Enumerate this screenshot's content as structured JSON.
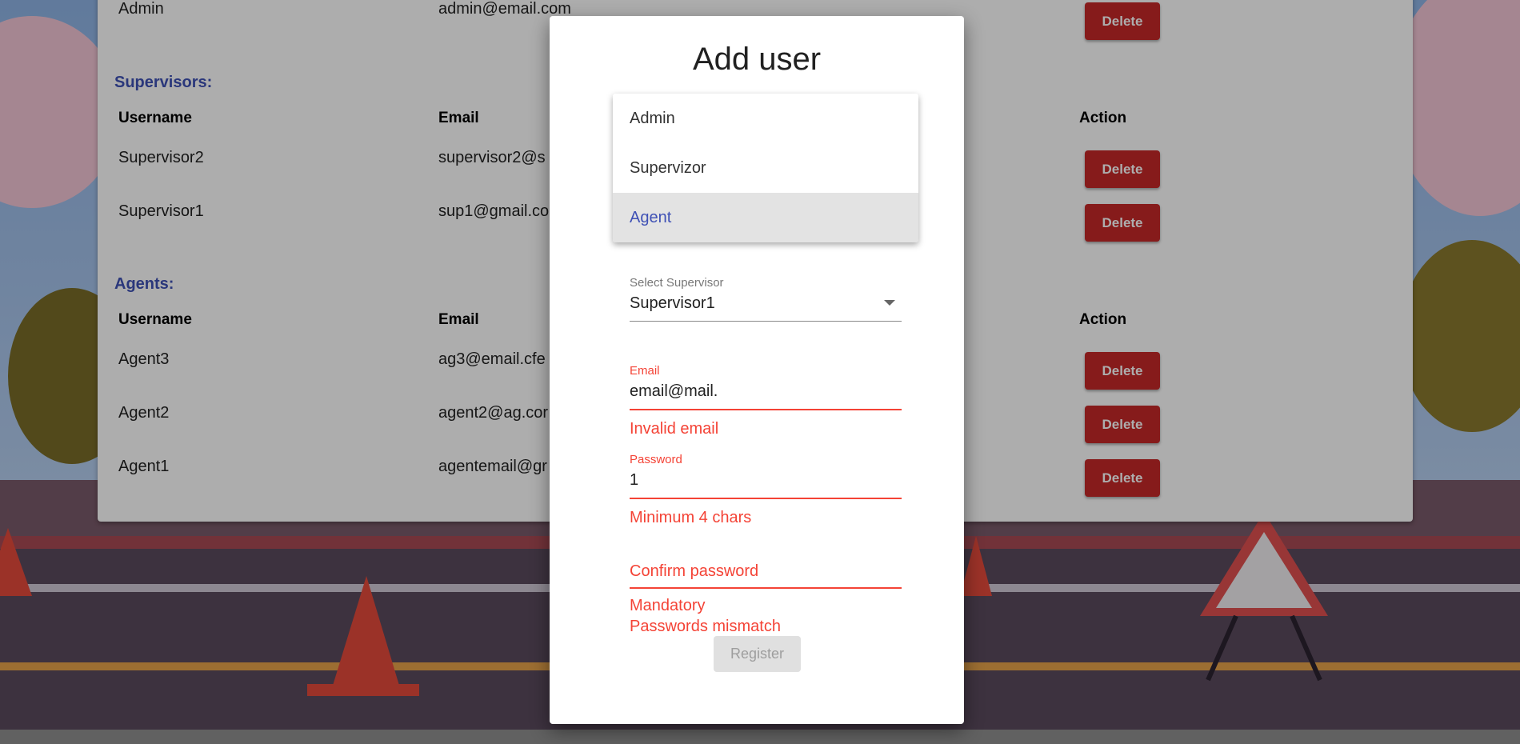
{
  "users": {
    "admin_row": {
      "username": "Admin",
      "email": "admin@email.com",
      "action": "Delete"
    },
    "supervisors": {
      "title": "Supervisors:",
      "headers": {
        "username": "Username",
        "email": "Email",
        "action": "Action"
      },
      "rows": [
        {
          "username": "Supervisor2",
          "email": "supervisor2@s",
          "action": "Delete"
        },
        {
          "username": "Supervisor1",
          "email": "sup1@gmail.co",
          "action": "Delete"
        }
      ]
    },
    "agents": {
      "title": "Agents:",
      "headers": {
        "username": "Username",
        "email": "Email",
        "action": "Action"
      },
      "rows": [
        {
          "username": "Agent3",
          "email": "ag3@email.cfe",
          "action": "Delete"
        },
        {
          "username": "Agent2",
          "email": "agent2@ag.cor",
          "action": "Delete"
        },
        {
          "username": "Agent1",
          "email": "agentemail@gr",
          "action": "Delete"
        }
      ]
    }
  },
  "dialog": {
    "title": "Add user",
    "role_options": [
      {
        "label": "Admin",
        "selected": false
      },
      {
        "label": "Supervizor",
        "selected": false
      },
      {
        "label": "Agent",
        "selected": true
      }
    ],
    "supervisor_select": {
      "label": "Select Supervisor",
      "value": "Supervisor1"
    },
    "email": {
      "label": "Email",
      "value": "email@mail.",
      "error": "Invalid email"
    },
    "password": {
      "label": "Password",
      "value": "1",
      "error": "Minimum 4 chars"
    },
    "confirm_password": {
      "placeholder": "Confirm password",
      "errors": [
        "Mandatory",
        "Passwords mismatch"
      ]
    },
    "register_label": "Register"
  },
  "colors": {
    "accent": "#3f51b5",
    "danger": "#c62828",
    "error": "#f44336",
    "disabled": "#e0e0e0"
  }
}
